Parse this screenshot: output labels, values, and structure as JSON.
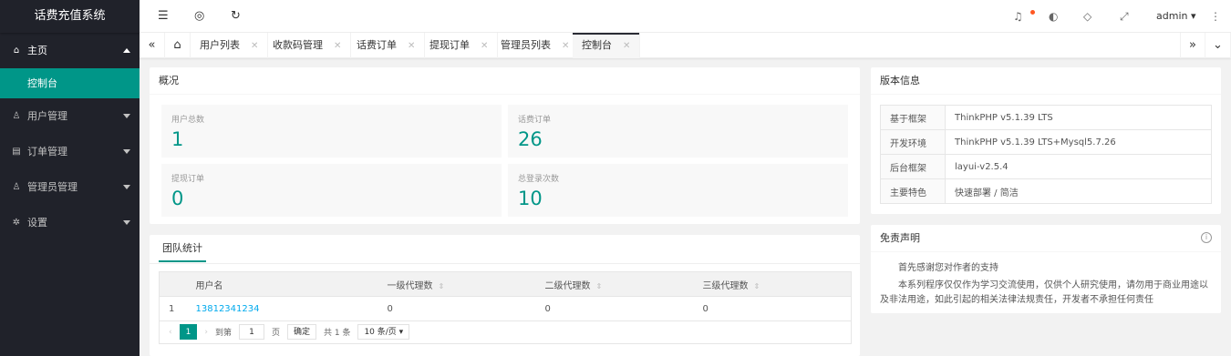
{
  "sidebar": {
    "logo": "话费充值系统",
    "items": [
      {
        "label": "主页",
        "icon": "home-icon"
      },
      {
        "label": "用户管理",
        "icon": "user-icon"
      },
      {
        "label": "订单管理",
        "icon": "order-icon"
      },
      {
        "label": "管理员管理",
        "icon": "admin-icon"
      },
      {
        "label": "设置",
        "icon": "gear-icon"
      }
    ],
    "active_sub": "控制台"
  },
  "header": {
    "user": "admin",
    "icons": [
      "menu-toggle-icon",
      "globe-icon",
      "refresh-icon",
      "bell-icon",
      "theme-icon",
      "tag-icon",
      "fullscreen-icon",
      "more-icon"
    ]
  },
  "tabs": [
    "用户列表",
    "收款码管理",
    "话费订单",
    "提现订单",
    "管理员列表",
    "控制台"
  ],
  "overview": {
    "title": "概况",
    "stats": [
      {
        "label": "用户总数",
        "value": "1"
      },
      {
        "label": "话费订单",
        "value": "26"
      },
      {
        "label": "提现订单",
        "value": "0"
      },
      {
        "label": "总登录次数",
        "value": "10"
      }
    ]
  },
  "team": {
    "tab": "团队统计",
    "columns": [
      "用户名",
      "一级代理数",
      "二级代理数",
      "三级代理数"
    ],
    "rows": [
      {
        "index": "1",
        "username": "13812341234",
        "l1": "0",
        "l2": "0",
        "l3": "0"
      }
    ],
    "pager": {
      "page": "1",
      "goto": "到第",
      "input": "1",
      "page_unit": "页",
      "confirm": "确定",
      "total": "共 1 条",
      "per_page": "10 条/页"
    }
  },
  "version": {
    "title": "版本信息",
    "rows": [
      {
        "k": "基于框架",
        "v": "ThinkPHP v5.1.39 LTS"
      },
      {
        "k": "开发环境",
        "v": "ThinkPHP v5.1.39 LTS+Mysql5.7.26"
      },
      {
        "k": "后台框架",
        "v": "layui-v2.5.4"
      },
      {
        "k": "主要特色",
        "v": "快速部署 / 简洁"
      }
    ]
  },
  "disclaimer": {
    "title": "免责声明",
    "line1": "首先感谢您对作者的支持",
    "line2": "本系列程序仅仅作为学习交流使用，仅供个人研究使用，请勿用于商业用途以及非法用途，如此引起的相关法律法规责任，开发者不承担任何责任"
  },
  "colors": {
    "accent": "#009688",
    "sidebar": "#20222a",
    "badge": "#ff5722"
  }
}
